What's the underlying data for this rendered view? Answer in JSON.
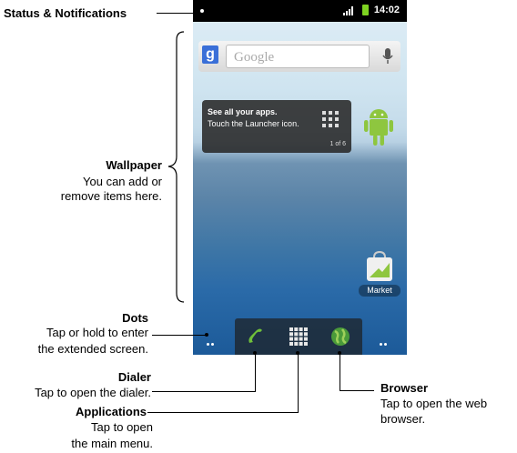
{
  "status_bar": {
    "time": "14:02"
  },
  "search_widget": {
    "placeholder": "Google",
    "logo": "g"
  },
  "launcher_tip": {
    "title": "See all your apps.",
    "text": "Touch the Launcher icon.",
    "counter": "1 of 6"
  },
  "market_label": "Market",
  "callouts": {
    "status": "Status & Notifications",
    "wallpaper_title": "Wallpaper",
    "wallpaper_line1": "You can add or",
    "wallpaper_line2": "remove items here.",
    "dots_title": "Dots",
    "dots_line1": "Tap or hold to enter",
    "dots_line2": "the extended screen.",
    "dialer_title": "Dialer",
    "dialer_line1": "Tap to open the dialer.",
    "apps_title": "Applications",
    "apps_line1": "Tap  to  open",
    "apps_line2": "the main menu.",
    "browser_title": "Browser",
    "browser_line1": "Tap to open the web",
    "browser_line2": "browser."
  },
  "colors": {
    "battery": "#7ed321",
    "dock": "#1e1e1e",
    "accent_blue": "#2a6aa8"
  }
}
